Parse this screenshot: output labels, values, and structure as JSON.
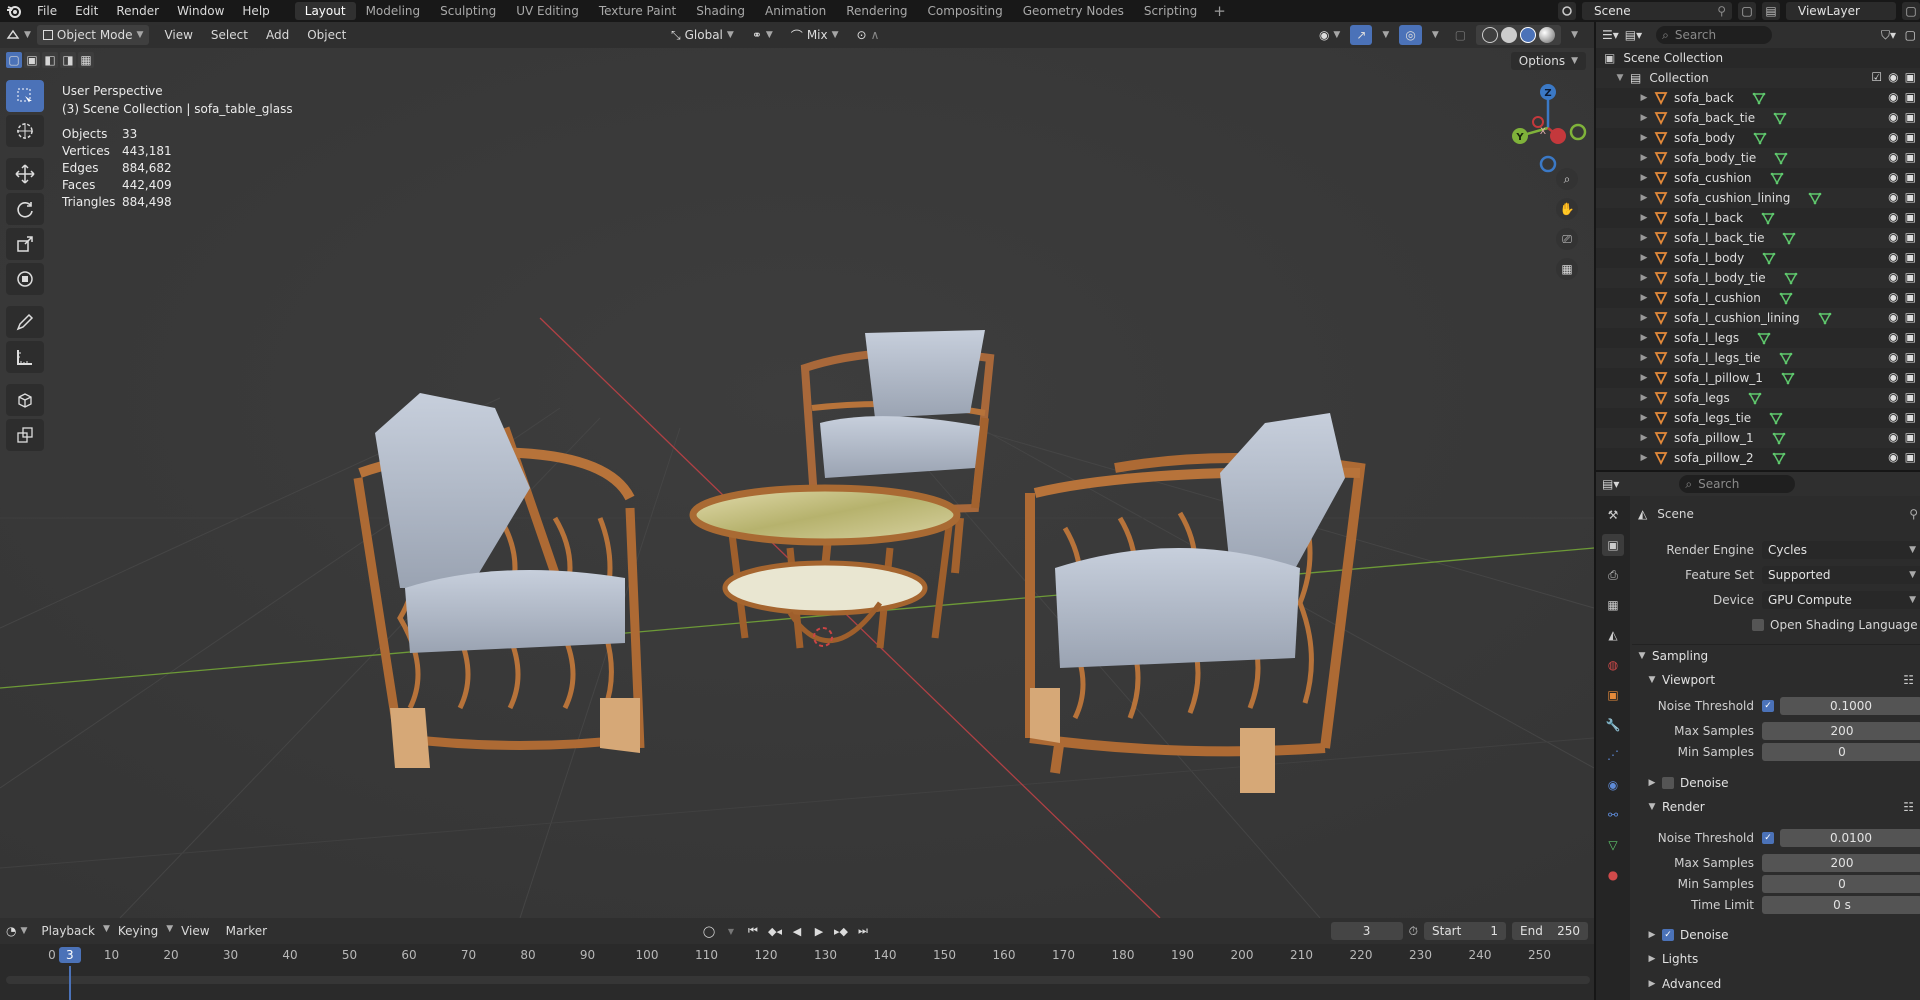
{
  "app": {
    "menu": [
      "File",
      "Edit",
      "Render",
      "Window",
      "Help"
    ],
    "workspaces": [
      "Layout",
      "Modeling",
      "Sculpting",
      "UV Editing",
      "Texture Paint",
      "Shading",
      "Animation",
      "Rendering",
      "Compositing",
      "Geometry Nodes",
      "Scripting"
    ],
    "active_workspace": "Layout",
    "scene_name": "Scene",
    "view_layer": "ViewLayer"
  },
  "viewport_header": {
    "mode": "Object Mode",
    "menus": [
      "View",
      "Select",
      "Add",
      "Object"
    ],
    "transform_orientation": "Global",
    "pivot": "Mix",
    "options_label": "Options"
  },
  "viewport": {
    "view_name": "User Perspective",
    "context": "(3) Scene Collection | sofa_table_glass",
    "stats": [
      {
        "label": "Objects",
        "value": "33"
      },
      {
        "label": "Vertices",
        "value": "443,181"
      },
      {
        "label": "Edges",
        "value": "884,682"
      },
      {
        "label": "Faces",
        "value": "442,409"
      },
      {
        "label": "Triangles",
        "value": "884,498"
      }
    ],
    "gizmo": {
      "x": "X",
      "y": "Y",
      "z": "Z"
    }
  },
  "timeline": {
    "menus": [
      "Playback",
      "Keying",
      "View",
      "Marker"
    ],
    "current_frame": "3",
    "start_label": "Start",
    "start": "1",
    "end_label": "End",
    "end": "250",
    "ruler_ticks": [
      "0",
      "10",
      "20",
      "30",
      "40",
      "50",
      "60",
      "70",
      "80",
      "90",
      "100",
      "110",
      "120",
      "130",
      "140",
      "150",
      "160",
      "170",
      "180",
      "190",
      "200",
      "210",
      "220",
      "230",
      "240",
      "250"
    ]
  },
  "outliner": {
    "search_placeholder": "Search",
    "root": "Scene Collection",
    "collection": "Collection",
    "items": [
      "sofa_back",
      "sofa_back_tie",
      "sofa_body",
      "sofa_body_tie",
      "sofa_cushion",
      "sofa_cushion_lining",
      "sofa_l_back",
      "sofa_l_back_tie",
      "sofa_l_body",
      "sofa_l_body_tie",
      "sofa_l_cushion",
      "sofa_l_cushion_lining",
      "sofa_l_legs",
      "sofa_l_legs_tie",
      "sofa_l_pillow_1",
      "sofa_legs",
      "sofa_legs_tie",
      "sofa_pillow_1",
      "sofa_pillow_2"
    ]
  },
  "properties": {
    "search_placeholder": "Search",
    "context": "Scene",
    "render_engine_label": "Render Engine",
    "render_engine": "Cycles",
    "feature_set_label": "Feature Set",
    "feature_set": "Supported",
    "device_label": "Device",
    "device": "GPU Compute",
    "osl_label": "Open Shading Language",
    "sampling": "Sampling",
    "viewport_section": "Viewport",
    "noise_threshold_label": "Noise Threshold",
    "viewport_noise_threshold": "0.1000",
    "max_samples_label": "Max Samples",
    "viewport_max_samples": "200",
    "min_samples_label": "Min Samples",
    "viewport_min_samples": "0",
    "denoise_label": "Denoise",
    "render_section": "Render",
    "render_noise_threshold": "0.0100",
    "render_max_samples": "200",
    "render_min_samples": "0",
    "time_limit_label": "Time Limit",
    "time_limit": "0 s",
    "lights": "Lights",
    "advanced": "Advanced"
  },
  "colors": {
    "accent": "#4b72b8",
    "x_axis": "#c4383c",
    "y_axis": "#7fb23a",
    "z_axis": "#3b79c6",
    "rattan": "#b7733a",
    "fabric": "#b2bccb"
  }
}
